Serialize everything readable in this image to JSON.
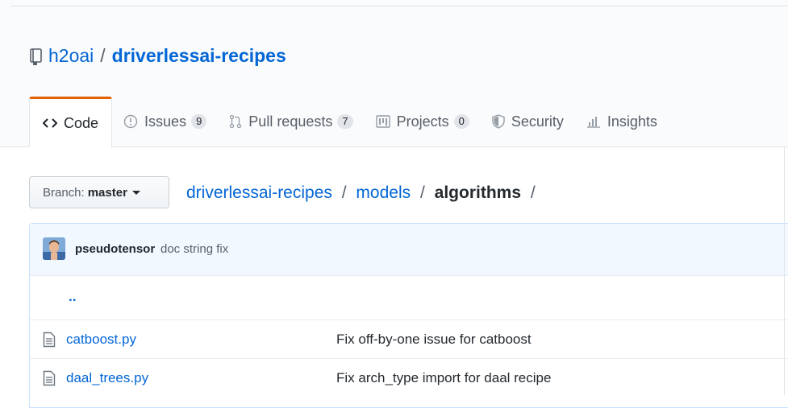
{
  "repo": {
    "owner": "h2oai",
    "separator": "/",
    "name": "driverlessai-recipes"
  },
  "tabs": [
    {
      "label": "Code",
      "icon": "code-icon",
      "counter": null,
      "selected": true
    },
    {
      "label": "Issues",
      "icon": "issue-icon",
      "counter": "9",
      "selected": false
    },
    {
      "label": "Pull requests",
      "icon": "pull-request-icon",
      "counter": "7",
      "selected": false
    },
    {
      "label": "Projects",
      "icon": "project-icon",
      "counter": "0",
      "selected": false
    },
    {
      "label": "Security",
      "icon": "shield-icon",
      "counter": null,
      "selected": false
    },
    {
      "label": "Insights",
      "icon": "graph-icon",
      "counter": null,
      "selected": false
    }
  ],
  "branch": {
    "label": "Branch:",
    "value": "master"
  },
  "breadcrumb": {
    "root": "driverlessai-recipes",
    "parent": "models",
    "current": "algorithms",
    "sep": "/"
  },
  "commit": {
    "author": "pseudotensor",
    "message": "doc string fix"
  },
  "files": {
    "up_link": "..",
    "rows": [
      {
        "name": "catboost.py",
        "message": "Fix off-by-one issue for catboost"
      },
      {
        "name": "daal_trees.py",
        "message": "Fix arch_type import for daal recipe"
      }
    ]
  },
  "colors": {
    "link": "#0366d6",
    "accent_tab": "#e36209",
    "commit_bg": "#f1f8ff"
  }
}
